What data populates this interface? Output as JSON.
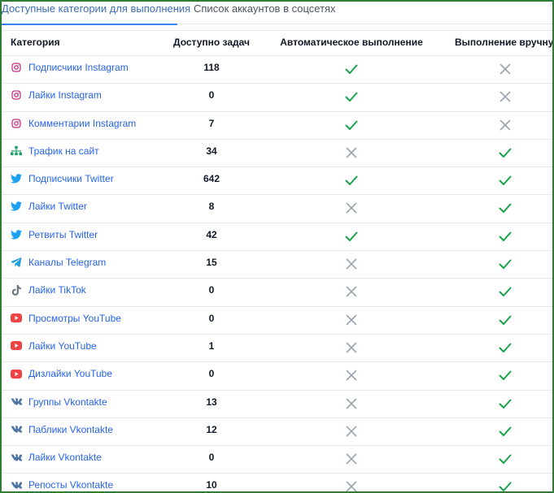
{
  "tabs": {
    "active": "Доступные категории для выполнения",
    "secondary": "Список аккаунтов в соцсетях"
  },
  "columns": {
    "category": "Категория",
    "available": "Доступно задач",
    "auto": "Автоматическое выполнение",
    "manual": "Выполнение вручную"
  },
  "colors": {
    "check": "#16a34a",
    "cross": "#9ca3af",
    "instagram": "#c13584",
    "site": "#22a06b",
    "twitter": "#1da1f2",
    "telegram": "#229ed9",
    "tiktok": "#6b7280",
    "youtube": "#ef4444",
    "vk": "#4c75a3"
  },
  "rows": [
    {
      "label": "Подписчики Instagram",
      "icon": "instagram-icon",
      "count": "118",
      "auto": true,
      "manual": false
    },
    {
      "label": "Лайки Instagram",
      "icon": "instagram-icon",
      "count": "0",
      "auto": true,
      "manual": false
    },
    {
      "label": "Комментарии Instagram",
      "icon": "instagram-icon",
      "count": "7",
      "auto": true,
      "manual": false
    },
    {
      "label": "Трафик на сайт",
      "icon": "sitemap-icon",
      "count": "34",
      "auto": false,
      "manual": true
    },
    {
      "label": "Подписчики Twitter",
      "icon": "twitter-icon",
      "count": "642",
      "auto": true,
      "manual": true
    },
    {
      "label": "Лайки Twitter",
      "icon": "twitter-icon",
      "count": "8",
      "auto": false,
      "manual": true
    },
    {
      "label": "Ретвиты Twitter",
      "icon": "twitter-icon",
      "count": "42",
      "auto": true,
      "manual": true
    },
    {
      "label": "Каналы Telegram",
      "icon": "telegram-icon",
      "count": "15",
      "auto": false,
      "manual": true
    },
    {
      "label": "Лайки TikTok",
      "icon": "tiktok-icon",
      "count": "0",
      "auto": false,
      "manual": true
    },
    {
      "label": "Просмотры YouTube",
      "icon": "youtube-icon",
      "count": "0",
      "auto": false,
      "manual": true
    },
    {
      "label": "Лайки YouTube",
      "icon": "youtube-icon",
      "count": "1",
      "auto": false,
      "manual": true
    },
    {
      "label": "Дизлайки YouTube",
      "icon": "youtube-icon",
      "count": "0",
      "auto": false,
      "manual": true
    },
    {
      "label": "Группы Vkontakte",
      "icon": "vk-icon",
      "count": "13",
      "auto": false,
      "manual": true
    },
    {
      "label": "Паблики Vkontakte",
      "icon": "vk-icon",
      "count": "12",
      "auto": false,
      "manual": true
    },
    {
      "label": "Лайки Vkontakte",
      "icon": "vk-icon",
      "count": "0",
      "auto": false,
      "manual": true
    },
    {
      "label": "Репосты Vkontakte",
      "icon": "vk-icon",
      "count": "10",
      "auto": false,
      "manual": true
    }
  ]
}
